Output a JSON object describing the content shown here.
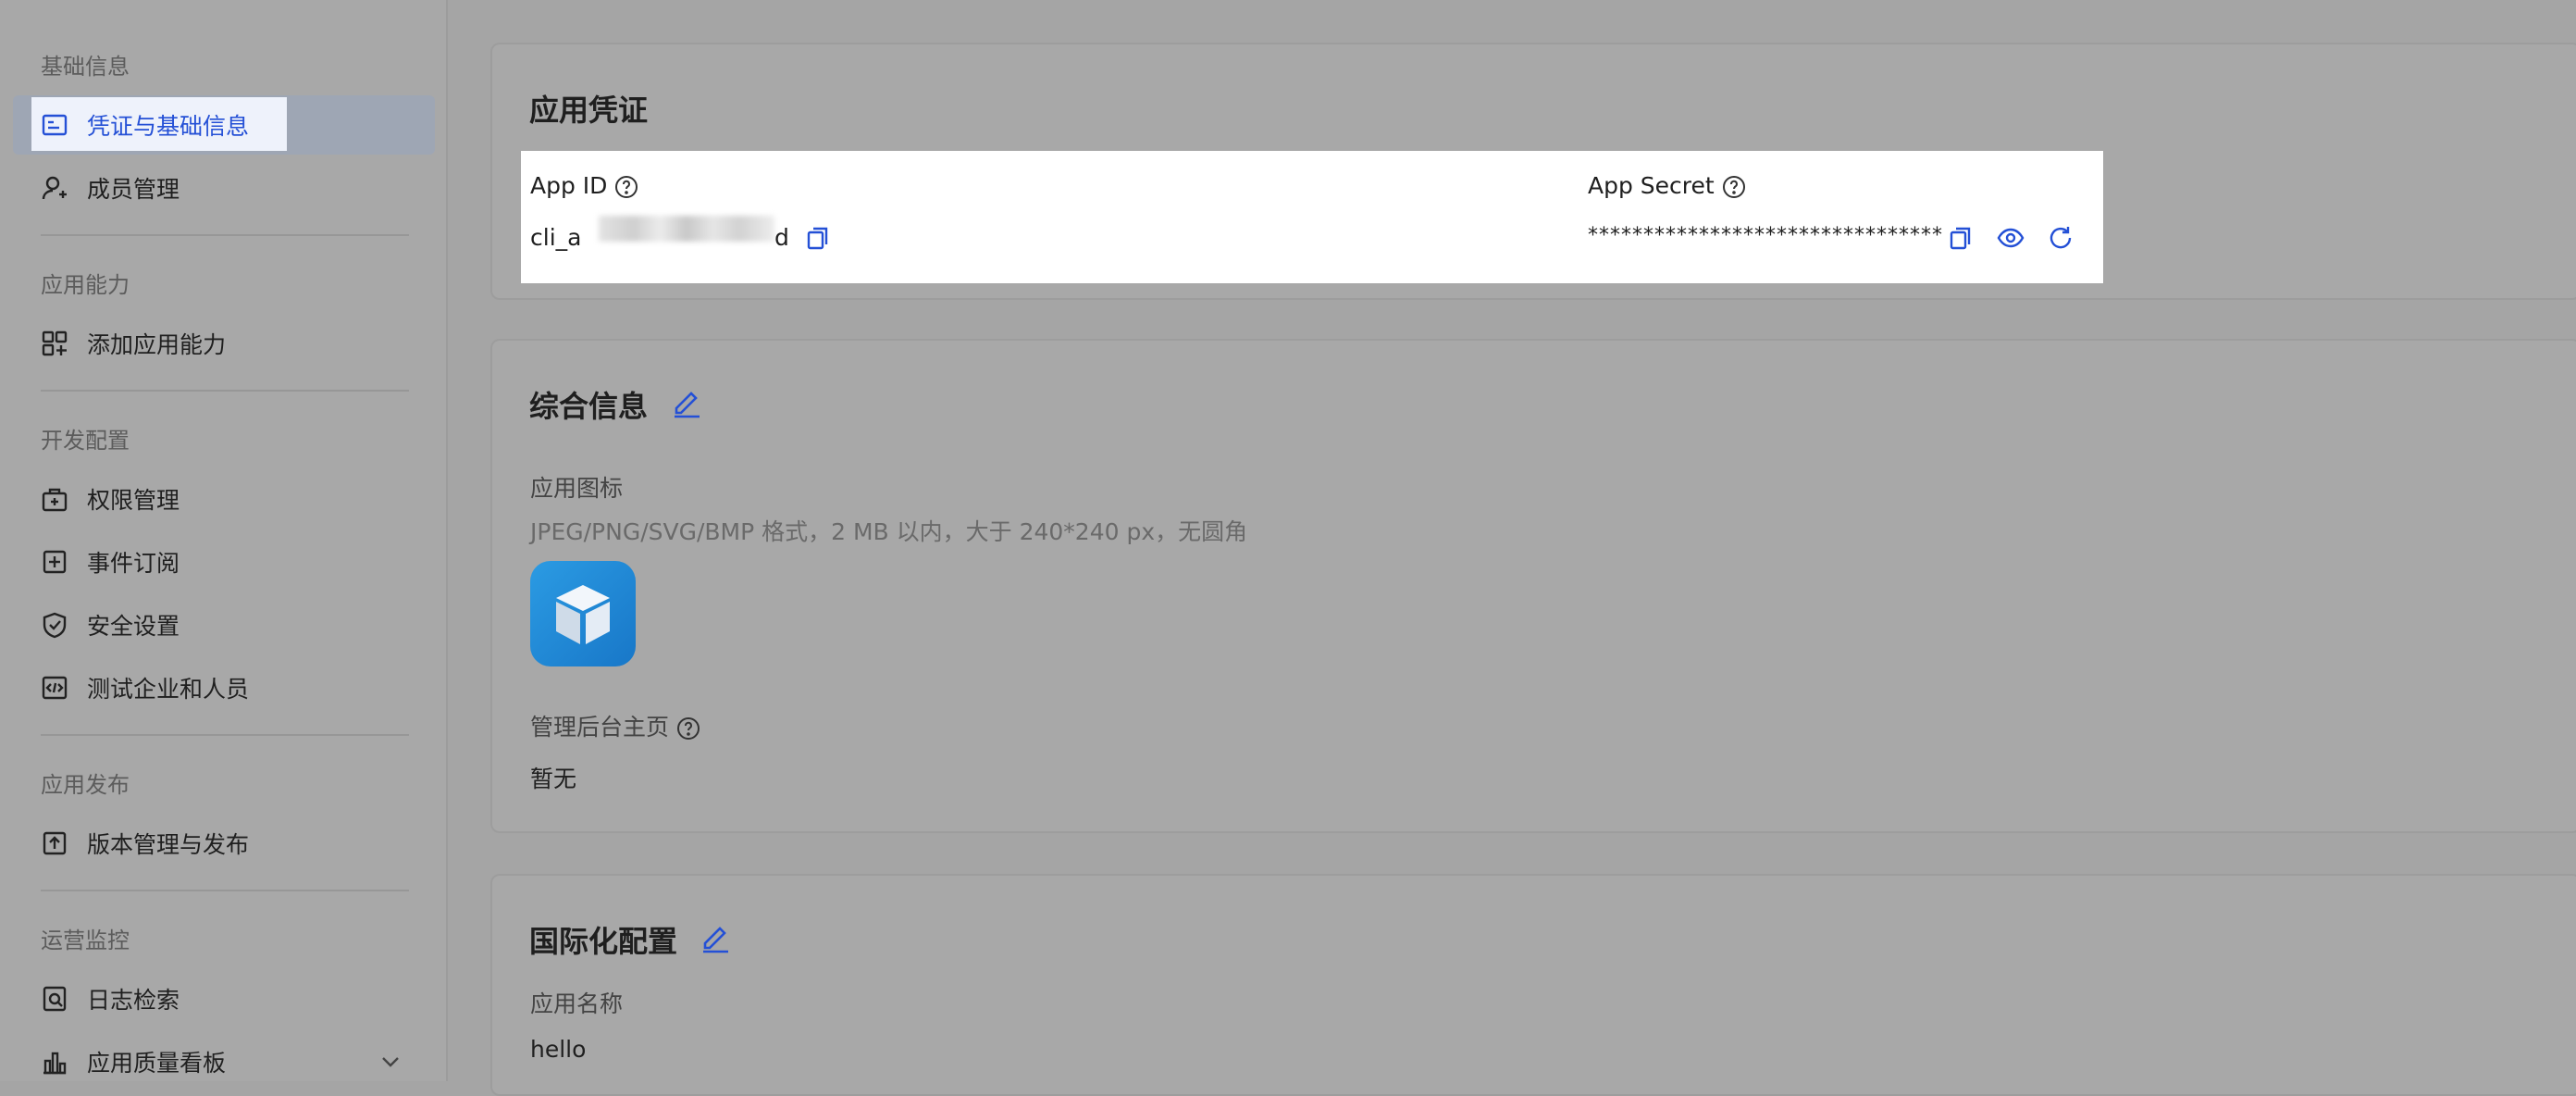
{
  "sidebar": {
    "sections": [
      {
        "title": "基础信息",
        "items": [
          {
            "label": "凭证与基础信息",
            "icon": "credential-icon",
            "active": true
          },
          {
            "label": "成员管理",
            "icon": "member-icon"
          }
        ]
      },
      {
        "title": "应用能力",
        "items": [
          {
            "label": "添加应用能力",
            "icon": "add-capability-icon"
          }
        ]
      },
      {
        "title": "开发配置",
        "items": [
          {
            "label": "权限管理",
            "icon": "permission-icon"
          },
          {
            "label": "事件订阅",
            "icon": "event-icon"
          },
          {
            "label": "安全设置",
            "icon": "shield-icon"
          },
          {
            "label": "测试企业和人员",
            "icon": "code-icon"
          }
        ]
      },
      {
        "title": "应用发布",
        "items": [
          {
            "label": "版本管理与发布",
            "icon": "upload-icon"
          }
        ]
      },
      {
        "title": "运营监控",
        "items": [
          {
            "label": "日志检索",
            "icon": "log-search-icon"
          },
          {
            "label": "应用质量看板",
            "icon": "chart-icon"
          }
        ]
      }
    ]
  },
  "credentials": {
    "title": "应用凭证",
    "app_id_label": "App ID",
    "app_id_prefix": "cli_a",
    "app_id_suffix": "d",
    "app_secret_label": "App Secret",
    "app_secret_value": "********************************"
  },
  "general": {
    "title": "综合信息",
    "icon_label": "应用图标",
    "icon_hint": "JPEG/PNG/SVG/BMP 格式，2 MB 以内，大于 240*240 px，无圆角",
    "admin_label": "管理后台主页",
    "admin_value": "暂无"
  },
  "i18n": {
    "title": "国际化配置",
    "name_label": "应用名称",
    "name_value": "hello"
  },
  "colors": {
    "accent": "#2450d6"
  }
}
